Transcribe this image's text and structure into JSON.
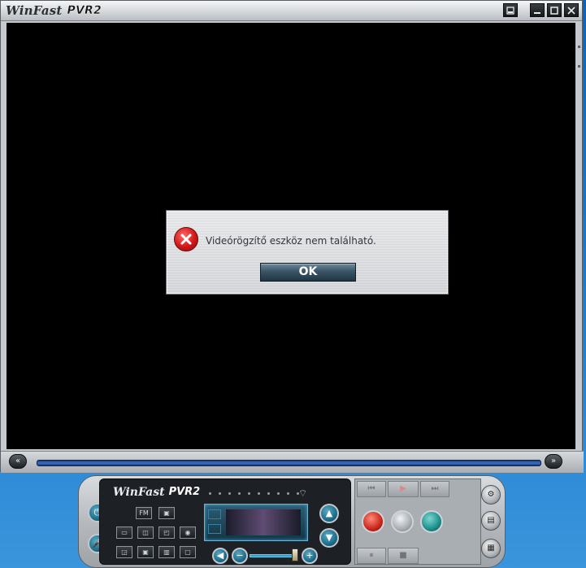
{
  "window": {
    "logo_text": "WinFast",
    "logo_pvr": "PVR2",
    "buttons": [
      "snapshot-icon",
      "minimize-icon",
      "maximize-icon",
      "close-icon"
    ]
  },
  "dialog": {
    "message": "Videórögzítő eszköz nem található.",
    "ok_label": "OK"
  },
  "panel": {
    "logo_text": "WinFast",
    "logo_pvr": "PVR2",
    "fm_label": "FM",
    "seek_back_label": "«",
    "seek_fwd_label": "»"
  },
  "colors": {
    "desktop": "#1f7fd0",
    "video": "#000000",
    "error_red": "#d11818",
    "lcd_border": "#6fb4d4"
  }
}
